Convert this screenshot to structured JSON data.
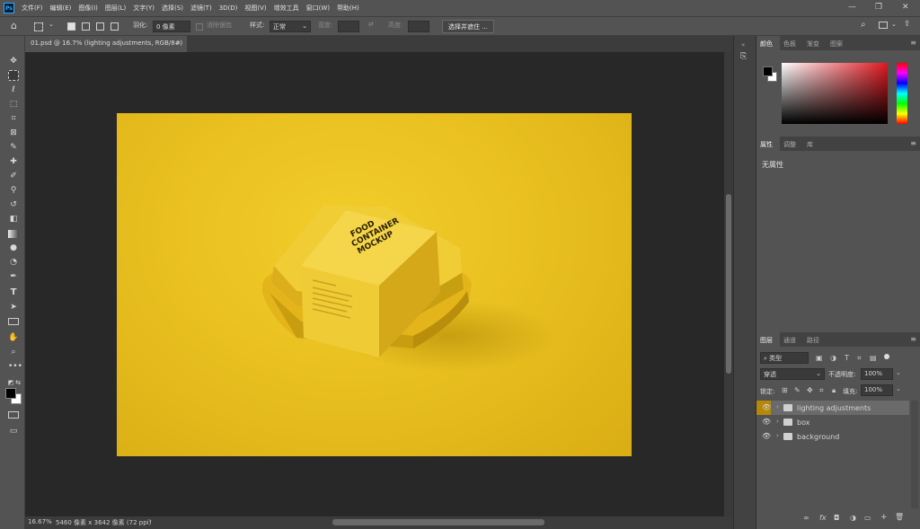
{
  "menu": {
    "logo": "Ps",
    "items": [
      "文件(F)",
      "编辑(E)",
      "图像(I)",
      "图层(L)",
      "文字(Y)",
      "选择(S)",
      "滤镜(T)",
      "3D(D)",
      "视图(V)",
      "增效工具",
      "窗口(W)",
      "帮助(H)"
    ],
    "window_controls": [
      "—",
      "❐",
      "✕"
    ]
  },
  "options": {
    "feather_label": "羽化:",
    "feather_value": "0 像素",
    "antialias_label": "消除锯齿",
    "style_label": "样式:",
    "style_value": "正常",
    "width_label": "宽度:",
    "height_label": "高度:",
    "select_mask_button": "选择并遮住 ..."
  },
  "document": {
    "tab_title": "01.psd @ 16.7% (lighting adjustments, RGB/8#)",
    "tab_close": "×",
    "zoom": "16.67%",
    "doc_size": "5460 像素 x 3642 像素 (72 ppi)",
    "status_arrow": "›"
  },
  "artwork": {
    "box_lines": [
      "FOOD",
      "CONTAINER",
      "MOCKUP"
    ],
    "background_color": "#eac31f",
    "box_color": "#f2cf3a"
  },
  "color_panel": {
    "tabs": [
      "颜色",
      "色板",
      "渐变",
      "图案"
    ],
    "active_tab": 0,
    "hue_color": "#e01820"
  },
  "properties_panel": {
    "tabs": [
      "属性",
      "调整",
      "库"
    ],
    "active_tab": 0,
    "empty_text": "无属性"
  },
  "layers_panel": {
    "tabs": [
      "图层",
      "通道",
      "路径"
    ],
    "active_tab": 0,
    "filter_label": "类型",
    "blend_mode": "穿透",
    "opacity_label": "不透明度:",
    "opacity_value": "100%",
    "lock_label": "锁定:",
    "fill_label": "填充:",
    "fill_value": "100%",
    "layers": [
      {
        "name": "lighting adjustments",
        "selected": true
      },
      {
        "name": "box",
        "selected": false
      },
      {
        "name": "background",
        "selected": false
      }
    ],
    "bottom_icons": [
      "∞",
      "fx",
      "◘",
      "◑",
      "▭",
      "+",
      "🗑"
    ]
  }
}
